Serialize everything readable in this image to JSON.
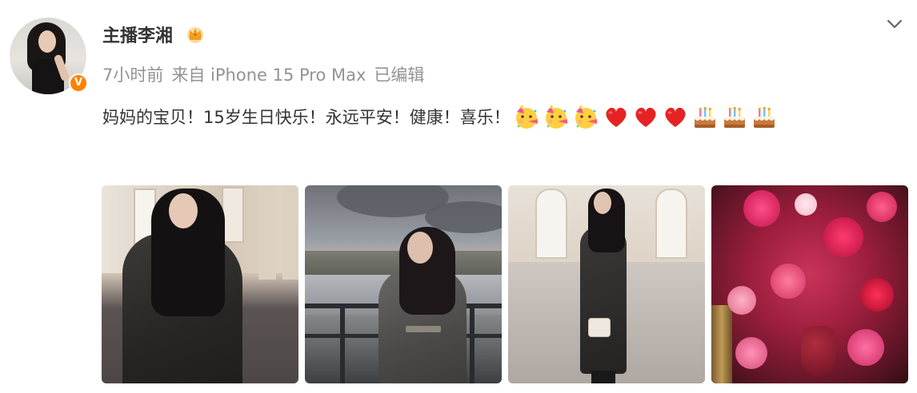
{
  "post": {
    "author": {
      "name": "主播李湘",
      "verified_badge": "V",
      "badge_icon": "crown-icon"
    },
    "meta": {
      "time": "7小时前",
      "source": "来自 iPhone 15 Pro Max",
      "edited": "已编辑"
    },
    "content": {
      "text": "妈妈的宝贝！15岁生日快乐！永远平安！健康！喜乐！",
      "emojis": [
        "party-face-icon",
        "party-face-icon",
        "party-face-icon",
        "red-heart-icon",
        "red-heart-icon",
        "red-heart-icon",
        "birthday-cake-icon",
        "birthday-cake-icon",
        "birthday-cake-icon"
      ]
    },
    "photos": [
      {
        "subject": "photo-1"
      },
      {
        "subject": "photo-2"
      },
      {
        "subject": "photo-3"
      },
      {
        "subject": "photo-4"
      }
    ],
    "menu_icon": "chevron-down-icon"
  },
  "colors": {
    "verified": "#ff8200",
    "meta_text": "#939393",
    "body_text": "#333333"
  }
}
